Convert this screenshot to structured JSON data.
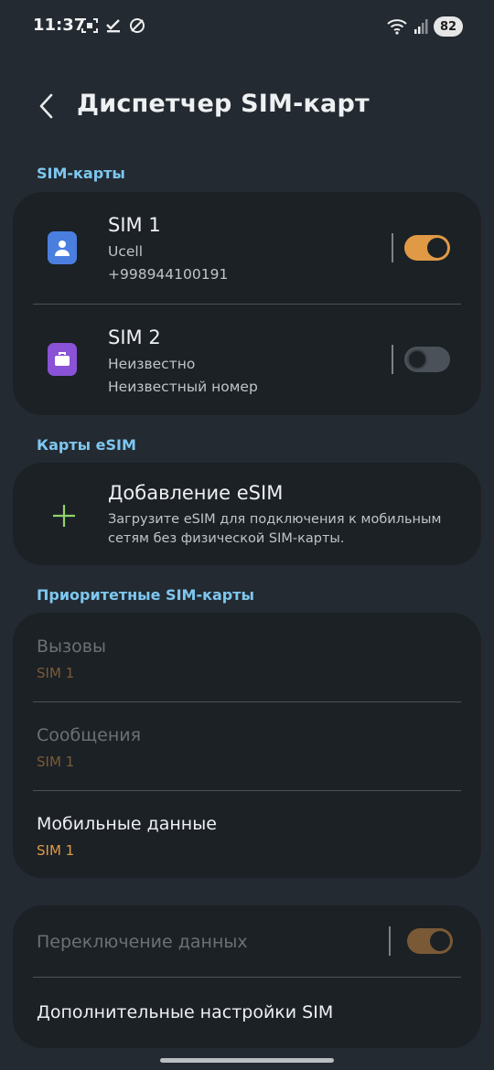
{
  "status_bar": {
    "time": "11:37",
    "battery": "82",
    "icons": [
      "screenshot-icon",
      "check-icon",
      "no-sync-icon",
      "wifi-icon",
      "signal-icon",
      "battery-icon"
    ]
  },
  "header": {
    "back_icon": "chevron-left-icon",
    "title": "Диспетчер SIM-карт"
  },
  "sections": {
    "sim_cards": "SIM-карты",
    "esim": "Карты eSIM",
    "priority": "Приоритетные SIM-карты"
  },
  "sims": [
    {
      "title": "SIM 1",
      "operator": "Ucell",
      "number": "+998944100191",
      "enabled": true,
      "icon": "person-icon",
      "icon_color": "#4a7fe0"
    },
    {
      "title": "SIM 2",
      "operator": "Неизвестно",
      "number": "Неизвестный номер",
      "enabled": false,
      "icon": "briefcase-icon",
      "icon_color": "#8a52d6"
    }
  ],
  "esim": {
    "title": "Добавление eSIM",
    "description_line1": "Загрузите eSIM для подключения к мобильным",
    "description_line2": "сетям без физической SIM-карты."
  },
  "priority": [
    {
      "title": "Вызовы",
      "value": "SIM 1",
      "enabled": false
    },
    {
      "title": "Сообщения",
      "value": "SIM 1",
      "enabled": false
    },
    {
      "title": "Мобильные данные",
      "value": "SIM 1",
      "enabled": true
    }
  ],
  "extra": {
    "data_switch": "Переключение данных",
    "data_switch_on": true,
    "more_settings": "Дополнительные настройки SIM"
  },
  "colors": {
    "accent": "#e09a45",
    "section_label": "#7ec7f0",
    "esim_plus": "#8fd36b",
    "background": "#232a31",
    "card": "#1c2126"
  }
}
